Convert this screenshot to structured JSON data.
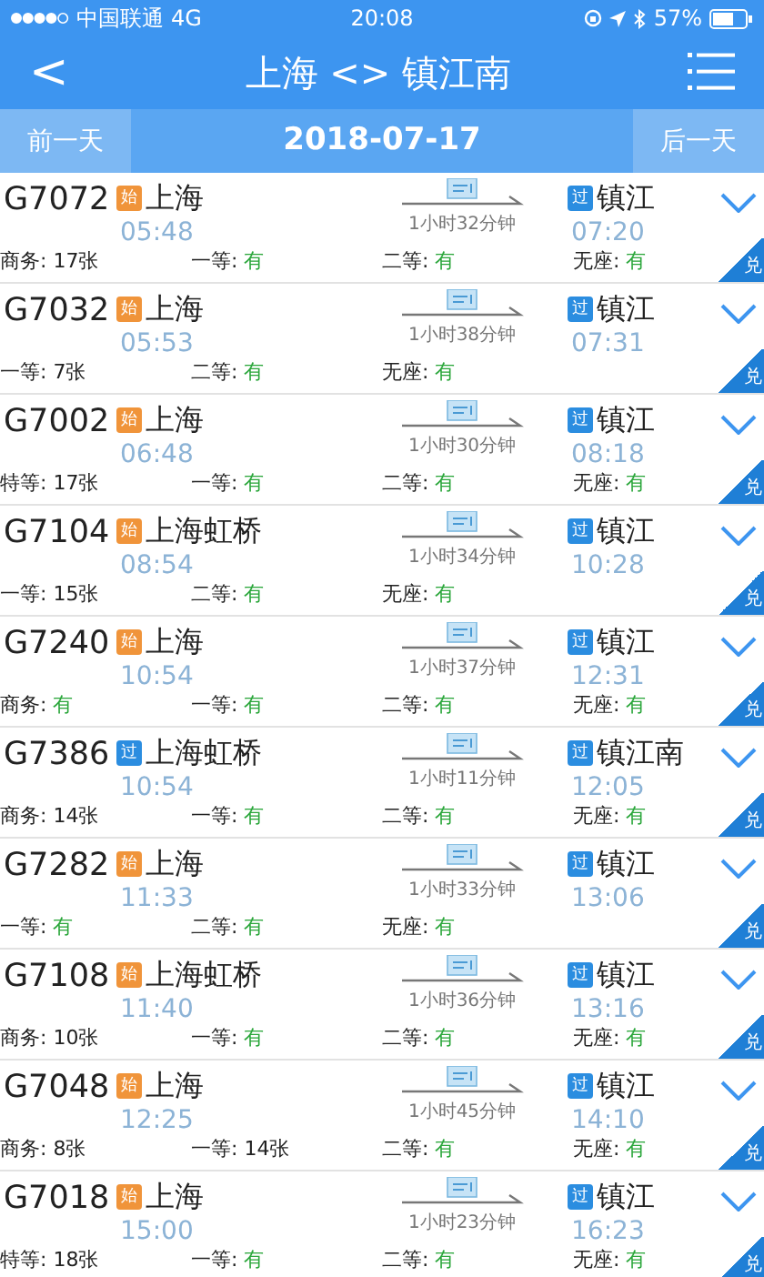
{
  "status_bar": {
    "carrier": "中国联通",
    "network": "4G",
    "time": "20:08",
    "battery": "57%"
  },
  "header": {
    "back": "<",
    "title": "上海 <> 镇江南"
  },
  "date_bar": {
    "prev": "前一天",
    "date": "2018-07-17",
    "next": "后一天"
  },
  "trains": [
    {
      "number": "G7072",
      "from": {
        "badge": "始",
        "kind": "origin",
        "station": "上海",
        "time": "05:48"
      },
      "duration": "1小时32分钟",
      "to": {
        "badge": "过",
        "kind": "pass",
        "station": "镇江",
        "time": "07:20"
      },
      "tag": "兑",
      "seats": [
        {
          "label": "商务:",
          "value": "17张",
          "kind": "count"
        },
        {
          "label": "一等:",
          "value": "有",
          "kind": "available"
        },
        {
          "label": "二等:",
          "value": "有",
          "kind": "available"
        },
        {
          "label": "无座:",
          "value": "有",
          "kind": "available"
        }
      ]
    },
    {
      "number": "G7032",
      "from": {
        "badge": "始",
        "kind": "origin",
        "station": "上海",
        "time": "05:53"
      },
      "duration": "1小时38分钟",
      "to": {
        "badge": "过",
        "kind": "pass",
        "station": "镇江",
        "time": "07:31"
      },
      "tag": "兑",
      "seats": [
        {
          "label": "一等:",
          "value": "7张",
          "kind": "count"
        },
        {
          "label": "二等:",
          "value": "有",
          "kind": "available"
        },
        {
          "label": "无座:",
          "value": "有",
          "kind": "available"
        }
      ]
    },
    {
      "number": "G7002",
      "from": {
        "badge": "始",
        "kind": "origin",
        "station": "上海",
        "time": "06:48"
      },
      "duration": "1小时30分钟",
      "to": {
        "badge": "过",
        "kind": "pass",
        "station": "镇江",
        "time": "08:18"
      },
      "tag": "兑",
      "seats": [
        {
          "label": "特等:",
          "value": "17张",
          "kind": "count"
        },
        {
          "label": "一等:",
          "value": "有",
          "kind": "available"
        },
        {
          "label": "二等:",
          "value": "有",
          "kind": "available"
        },
        {
          "label": "无座:",
          "value": "有",
          "kind": "available"
        }
      ]
    },
    {
      "number": "G7104",
      "from": {
        "badge": "始",
        "kind": "origin",
        "station": "上海虹桥",
        "time": "08:54"
      },
      "duration": "1小时34分钟",
      "to": {
        "badge": "过",
        "kind": "pass",
        "station": "镇江",
        "time": "10:28"
      },
      "tag": "兑",
      "seats": [
        {
          "label": "一等:",
          "value": "15张",
          "kind": "count"
        },
        {
          "label": "二等:",
          "value": "有",
          "kind": "available"
        },
        {
          "label": "无座:",
          "value": "有",
          "kind": "available"
        }
      ]
    },
    {
      "number": "G7240",
      "from": {
        "badge": "始",
        "kind": "origin",
        "station": "上海",
        "time": "10:54"
      },
      "duration": "1小时37分钟",
      "to": {
        "badge": "过",
        "kind": "pass",
        "station": "镇江",
        "time": "12:31"
      },
      "tag": "兑",
      "seats": [
        {
          "label": "商务:",
          "value": "有",
          "kind": "available"
        },
        {
          "label": "一等:",
          "value": "有",
          "kind": "available"
        },
        {
          "label": "二等:",
          "value": "有",
          "kind": "available"
        },
        {
          "label": "无座:",
          "value": "有",
          "kind": "available"
        }
      ]
    },
    {
      "number": "G7386",
      "from": {
        "badge": "过",
        "kind": "pass",
        "station": "上海虹桥",
        "time": "10:54"
      },
      "duration": "1小时11分钟",
      "to": {
        "badge": "过",
        "kind": "pass",
        "station": "镇江南",
        "time": "12:05"
      },
      "tag": "兑",
      "seats": [
        {
          "label": "商务:",
          "value": "14张",
          "kind": "count"
        },
        {
          "label": "一等:",
          "value": "有",
          "kind": "available"
        },
        {
          "label": "二等:",
          "value": "有",
          "kind": "available"
        },
        {
          "label": "无座:",
          "value": "有",
          "kind": "available"
        }
      ]
    },
    {
      "number": "G7282",
      "from": {
        "badge": "始",
        "kind": "origin",
        "station": "上海",
        "time": "11:33"
      },
      "duration": "1小时33分钟",
      "to": {
        "badge": "过",
        "kind": "pass",
        "station": "镇江",
        "time": "13:06"
      },
      "tag": "兑",
      "seats": [
        {
          "label": "一等:",
          "value": "有",
          "kind": "available"
        },
        {
          "label": "二等:",
          "value": "有",
          "kind": "available"
        },
        {
          "label": "无座:",
          "value": "有",
          "kind": "available"
        }
      ]
    },
    {
      "number": "G7108",
      "from": {
        "badge": "始",
        "kind": "origin",
        "station": "上海虹桥",
        "time": "11:40"
      },
      "duration": "1小时36分钟",
      "to": {
        "badge": "过",
        "kind": "pass",
        "station": "镇江",
        "time": "13:16"
      },
      "tag": "兑",
      "seats": [
        {
          "label": "商务:",
          "value": "10张",
          "kind": "count"
        },
        {
          "label": "一等:",
          "value": "有",
          "kind": "available"
        },
        {
          "label": "二等:",
          "value": "有",
          "kind": "available"
        },
        {
          "label": "无座:",
          "value": "有",
          "kind": "available"
        }
      ]
    },
    {
      "number": "G7048",
      "from": {
        "badge": "始",
        "kind": "origin",
        "station": "上海",
        "time": "12:25"
      },
      "duration": "1小时45分钟",
      "to": {
        "badge": "过",
        "kind": "pass",
        "station": "镇江",
        "time": "14:10"
      },
      "tag": "兑",
      "seats": [
        {
          "label": "商务:",
          "value": "8张",
          "kind": "count"
        },
        {
          "label": "一等:",
          "value": "14张",
          "kind": "count"
        },
        {
          "label": "二等:",
          "value": "有",
          "kind": "available"
        },
        {
          "label": "无座:",
          "value": "有",
          "kind": "available"
        }
      ]
    },
    {
      "number": "G7018",
      "from": {
        "badge": "始",
        "kind": "origin",
        "station": "上海",
        "time": "15:00"
      },
      "duration": "1小时23分钟",
      "to": {
        "badge": "过",
        "kind": "pass",
        "station": "镇江",
        "time": "16:23"
      },
      "tag": "兑",
      "seats": [
        {
          "label": "特等:",
          "value": "18张",
          "kind": "count"
        },
        {
          "label": "一等:",
          "value": "有",
          "kind": "available"
        },
        {
          "label": "二等:",
          "value": "有",
          "kind": "available"
        },
        {
          "label": "无座:",
          "value": "有",
          "kind": "available"
        }
      ]
    }
  ]
}
